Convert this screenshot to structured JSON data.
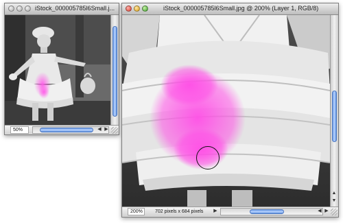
{
  "windows": {
    "left": {
      "title": "iStock_000005785l6Small.j...",
      "zoom": "50%",
      "scroll_arrows": {
        "left": "◀",
        "right": "▶"
      }
    },
    "right": {
      "title": "iStock_000005785l6Small.jpg @ 200% (Layer 1, RGB/8)",
      "zoom": "200%",
      "doc_info": "702 pixels x 684 pixels",
      "info_arrow": "▶",
      "scroll_arrows": {
        "left": "◀",
        "right": "▶",
        "up": "▲",
        "down": "▼"
      }
    }
  },
  "colors": {
    "window_bg": "#d8d8d8",
    "scroll_thumb": "#6f9ee6",
    "highlight_pink": "#ff4fe6",
    "canvas_gray": "#555555"
  }
}
